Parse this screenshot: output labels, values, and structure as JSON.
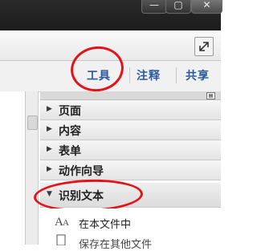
{
  "window_controls": {
    "minimize_label": "—",
    "maximize_label": "▢",
    "close_label": "✕"
  },
  "tabs": [
    {
      "label": "工具"
    },
    {
      "label": "注释"
    },
    {
      "label": "共享"
    }
  ],
  "panel": {
    "options_label": "▤",
    "sections": [
      {
        "label": "页面",
        "expanded": false
      },
      {
        "label": "内容",
        "expanded": false
      },
      {
        "label": "表单",
        "expanded": false
      },
      {
        "label": "动作向导",
        "expanded": false
      },
      {
        "label": "识别文本",
        "expanded": true
      }
    ],
    "arrow_collapsed": "▶",
    "arrow_expanded": "▼",
    "subitems": [
      {
        "label": "在本文件中"
      },
      {
        "label": "保存在其他文件"
      }
    ]
  },
  "annotation_color": "#e4131a",
  "tab_color": "#2c58a0"
}
